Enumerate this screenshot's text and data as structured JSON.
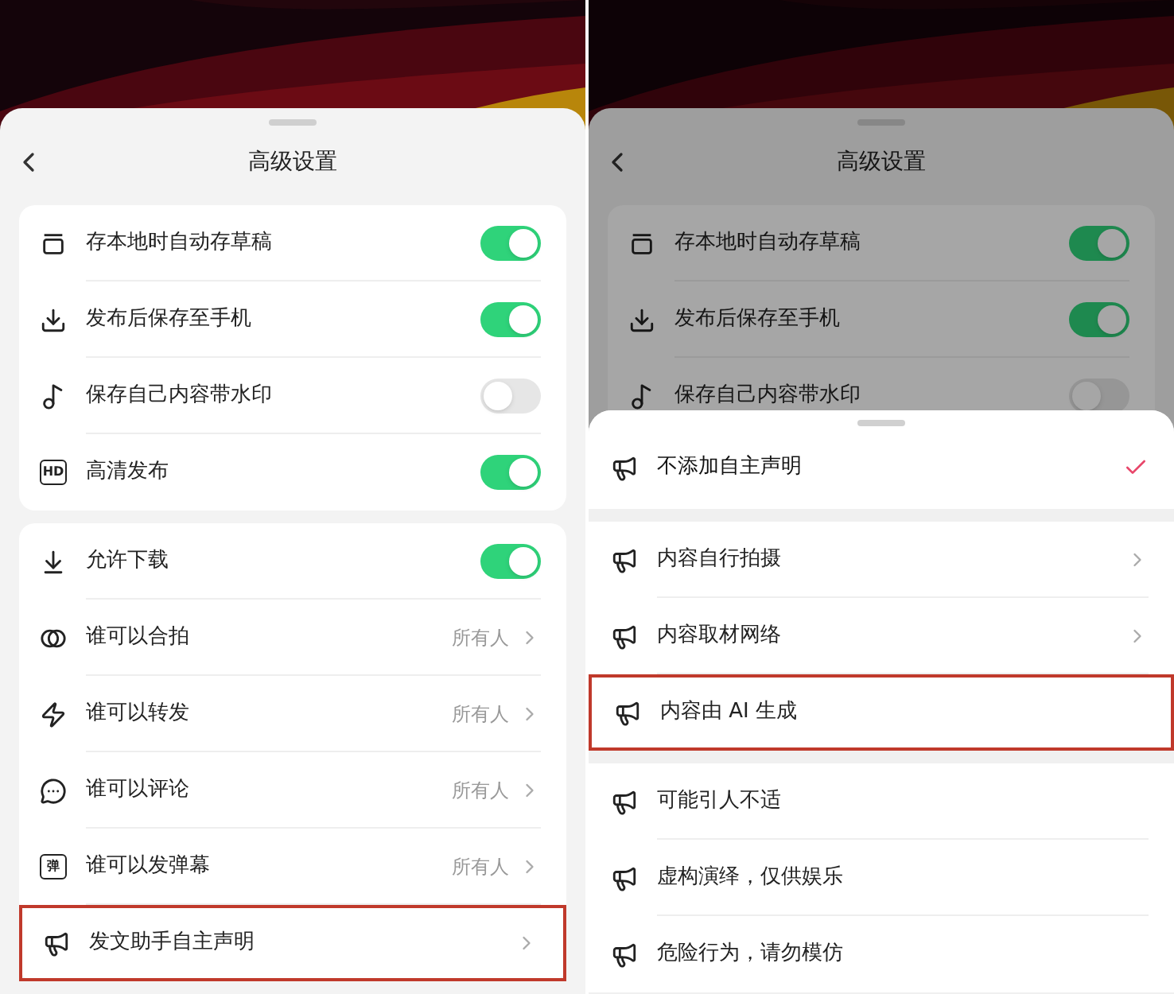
{
  "left_panel": {
    "title": "高级设置",
    "groups": [
      {
        "rows": [
          {
            "kind": "toggle",
            "label": "存本地时自动存草稿",
            "on": true,
            "highlighted": false
          },
          {
            "kind": "toggle",
            "label": "发布后保存至手机",
            "on": true,
            "highlighted": false
          },
          {
            "kind": "toggle",
            "label": "保存自己内容带水印",
            "on": false,
            "highlighted": false
          },
          {
            "kind": "toggle",
            "label": "高清发布",
            "icon_text": "HD",
            "on": true,
            "highlighted": false
          }
        ]
      },
      {
        "rows": [
          {
            "kind": "toggle",
            "label": "允许下载",
            "on": true,
            "highlighted": false
          },
          {
            "kind": "link",
            "label": "谁可以合拍",
            "value": "所有人",
            "highlighted": false
          },
          {
            "kind": "link",
            "label": "谁可以转发",
            "value": "所有人",
            "highlighted": false
          },
          {
            "kind": "link",
            "label": "谁可以评论",
            "value": "所有人",
            "highlighted": false
          },
          {
            "kind": "link",
            "label": "谁可以发弹幕",
            "icon_text": "弹",
            "value": "所有人",
            "highlighted": false
          },
          {
            "kind": "link",
            "label": "发文助手自主声明",
            "highlighted": true
          }
        ]
      }
    ]
  },
  "right_panel": {
    "title": "高级设置",
    "rows": [
      {
        "label": "存本地时自动存草稿",
        "on": true
      },
      {
        "label": "发布后保存至手机",
        "on": true
      },
      {
        "label": "保存自己内容带水印",
        "on": false
      }
    ],
    "declaration_sheet": {
      "groups": [
        [
          {
            "label": "不添加自主声明",
            "selected": true,
            "has_submenu": false,
            "highlighted": false
          }
        ],
        [
          {
            "label": "内容自行拍摄",
            "selected": false,
            "has_submenu": true,
            "highlighted": false
          },
          {
            "label": "内容取材网络",
            "selected": false,
            "has_submenu": true,
            "highlighted": false
          },
          {
            "label": "内容由 AI 生成",
            "selected": false,
            "has_submenu": false,
            "highlighted": true
          }
        ],
        [
          {
            "label": "可能引人不适",
            "selected": false,
            "has_submenu": false,
            "highlighted": false
          },
          {
            "label": "虚构演绎，仅供娱乐",
            "selected": false,
            "has_submenu": false,
            "highlighted": false
          },
          {
            "label": "危险行为，请勿模仿",
            "selected": false,
            "has_submenu": false,
            "highlighted": false
          }
        ]
      ]
    }
  }
}
